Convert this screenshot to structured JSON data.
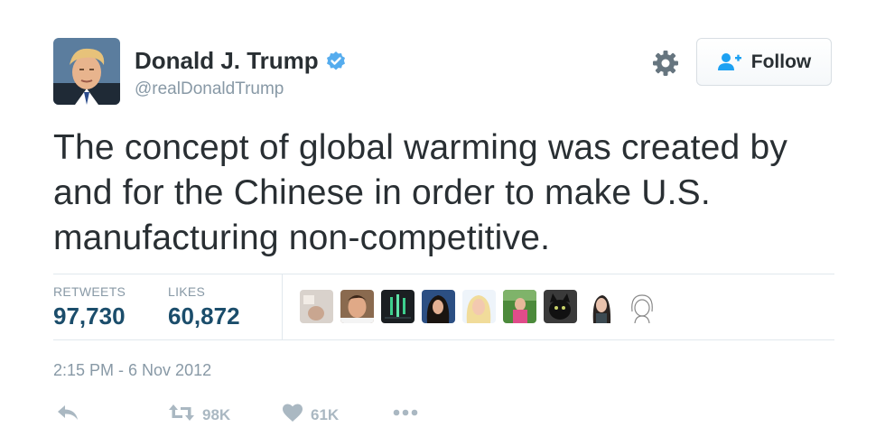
{
  "user": {
    "display_name": "Donald J. Trump",
    "handle": "@realDonaldTrump",
    "verified": true
  },
  "header": {
    "follow_label": "Follow",
    "gear_icon": "gear-icon",
    "follow_icon": "add-user-icon"
  },
  "tweet": {
    "text": "The concept of global warming was created by\nand for the Chinese in order to make U.S.\nmanufacturing non-competitive."
  },
  "stats": {
    "retweets_label": "RETWEETS",
    "retweets_value": "97,730",
    "likes_label": "LIKES",
    "likes_value": "60,872"
  },
  "likers_count_shown": 9,
  "timestamp": "2:15 PM - 6 Nov 2012",
  "actions": {
    "reply_icon": "reply-icon",
    "retweet_icon": "retweet-icon",
    "retweet_count": "98K",
    "like_icon": "heart-icon",
    "like_count": "61K",
    "more_icon": "more-icon"
  },
  "colors": {
    "text": "#292f33",
    "muted": "#8899a6",
    "stat_value": "#1b4d6b",
    "verified": "#55acee",
    "follow_icon": "#1da1f2",
    "action_icon": "#aab8c2",
    "divider": "#e1e8ed"
  }
}
